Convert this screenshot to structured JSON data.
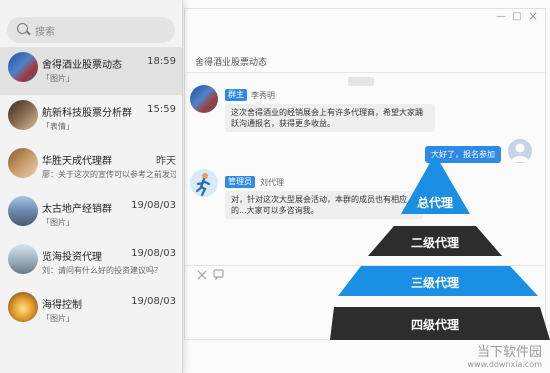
{
  "search": {
    "placeholder": "搜索"
  },
  "conversations": [
    {
      "name": "舍得酒业股票动态",
      "time": "18:59",
      "preview": "「图片」"
    },
    {
      "name": "航新科技股票分析群",
      "time": "15:59",
      "preview": "「表情」"
    },
    {
      "name": "华胜天成代理群",
      "time": "昨天",
      "preview": "廖：关于这次的宣传可以参考之前发过..."
    },
    {
      "name": "太古地产经销群",
      "time": "19/08/03",
      "preview": "「图片」"
    },
    {
      "name": "览海投资代理",
      "time": "19/08/03",
      "preview": "刘：请问有什么好的投资建议吗？"
    },
    {
      "name": "海得控制",
      "time": "19/08/03",
      "preview": "「图片」"
    }
  ],
  "chat": {
    "title": "舍得酒业股票动态",
    "messages": [
      {
        "role": "群主",
        "name": "李秀明",
        "text": "这次舍得酒业的经销展会上有许多代理商，希望大家踊跃沟通报名，获得更多收益。"
      },
      {
        "reply": "太好了，报名参加"
      },
      {
        "role": "管理员",
        "name": "刘代理",
        "text": "对，针对这次大型展会活动，本群的成员也有相应的...大家可以多咨询我。"
      }
    ]
  },
  "window_controls": {
    "minimize": "—",
    "maximize": "□",
    "close": "×"
  },
  "pyramid": {
    "levels": [
      "总代理",
      "二级代理",
      "三级代理",
      "四级代理"
    ],
    "colors": [
      "#1a8fe3",
      "#2d2d2d",
      "#1a8fe3",
      "#2d2d2d"
    ]
  },
  "watermark": {
    "line1": "当下软件园",
    "line2": "www.downxia.com"
  }
}
